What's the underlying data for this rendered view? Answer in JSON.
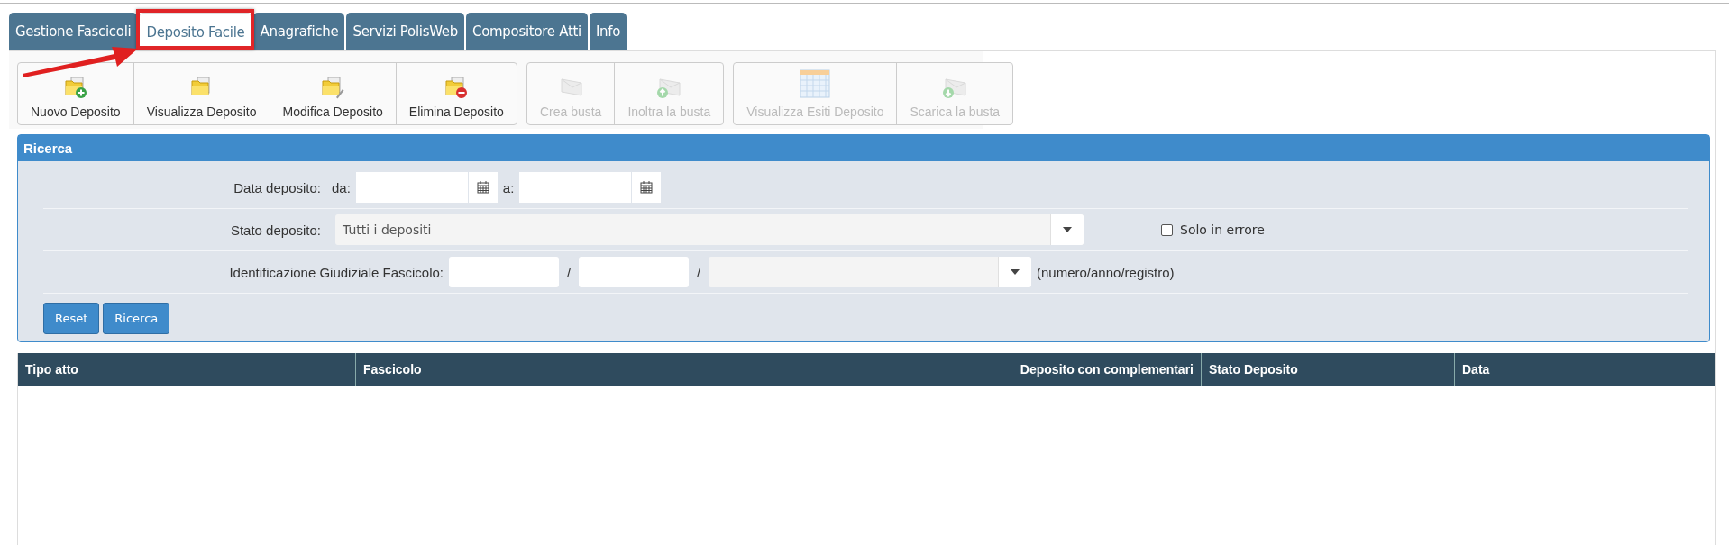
{
  "tabs": [
    {
      "label": "Gestione Fascicoli",
      "selected": false,
      "highlighted": false
    },
    {
      "label": "Deposito Facile",
      "selected": true,
      "highlighted": true
    },
    {
      "label": "Anagrafiche",
      "selected": false,
      "highlighted": false
    },
    {
      "label": "Servizi PolisWeb",
      "selected": false,
      "highlighted": false
    },
    {
      "label": "Compositore Atti",
      "selected": false,
      "highlighted": false
    },
    {
      "label": "Info",
      "selected": false,
      "highlighted": false
    }
  ],
  "toolbar": [
    {
      "buttons": [
        {
          "label": "Nuovo Deposito",
          "kind": "folderadd",
          "disabled": false
        },
        {
          "label": "Visualizza Deposito",
          "kind": "folder",
          "disabled": false
        },
        {
          "label": "Modifica Deposito",
          "kind": "folderedit",
          "disabled": false
        },
        {
          "label": "Elimina Deposito",
          "kind": "folderremove",
          "disabled": false
        }
      ]
    },
    {
      "buttons": [
        {
          "label": "Crea busta",
          "kind": "envelope",
          "disabled": true
        },
        {
          "label": "Inoltra la busta",
          "kind": "envelopeup",
          "disabled": true
        }
      ]
    },
    {
      "buttons": [
        {
          "label": "Visualizza Esiti Deposito",
          "kind": "calendar",
          "disabled": true
        },
        {
          "label": "Scarica la busta",
          "kind": "envelopedown",
          "disabled": true
        }
      ]
    }
  ],
  "search": {
    "title": "Ricerca",
    "date": {
      "label": "Data deposito:",
      "from_label": "da:",
      "to_label": "a:"
    },
    "status": {
      "label": "Stato deposito:",
      "value": "Tutti i depositi",
      "checkbox": {
        "label": "Solo in errore",
        "checked": false
      }
    },
    "ident": {
      "label": "Identificazione Giudiziale Fascicolo:",
      "separators": [
        "/",
        "/"
      ],
      "hint": "(numero/anno/registro)"
    },
    "buttons": [
      "Reset",
      "Ricerca"
    ]
  },
  "table": {
    "columns": [
      "Tipo atto",
      "Fascicolo",
      "Deposito con complementari",
      "Stato Deposito",
      "Data"
    ]
  }
}
